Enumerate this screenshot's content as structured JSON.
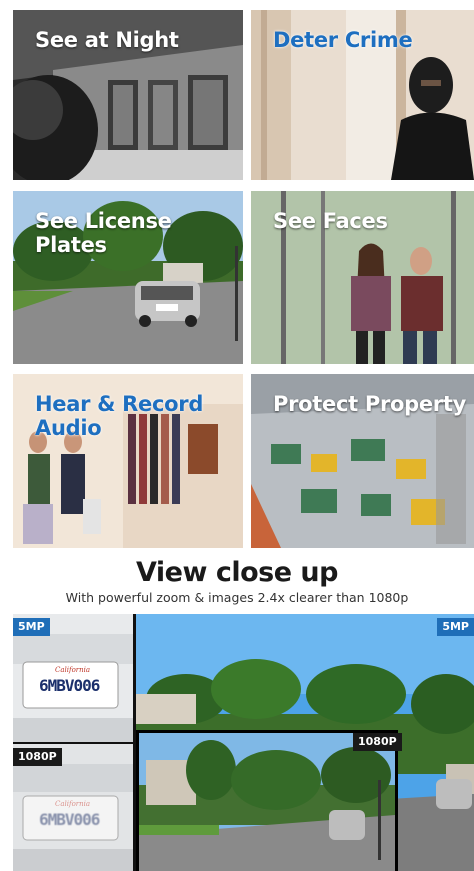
{
  "tiles": {
    "night": "See at Night",
    "crime": "Deter Crime",
    "plates": "See License Plates",
    "faces": "See Faces",
    "audio": "Hear & Record Audio",
    "protect": "Protect Property"
  },
  "section": {
    "title": "View close up",
    "subtitle": "With powerful zoom & images 2.4x clearer than 1080p"
  },
  "comparison": {
    "top_left_badge": "5MP",
    "top_right_badge": "5MP",
    "bottom_left_badge": "1080P",
    "inset_badge": "1080P",
    "plate_text": "6MBV006",
    "plate_state": "California"
  }
}
